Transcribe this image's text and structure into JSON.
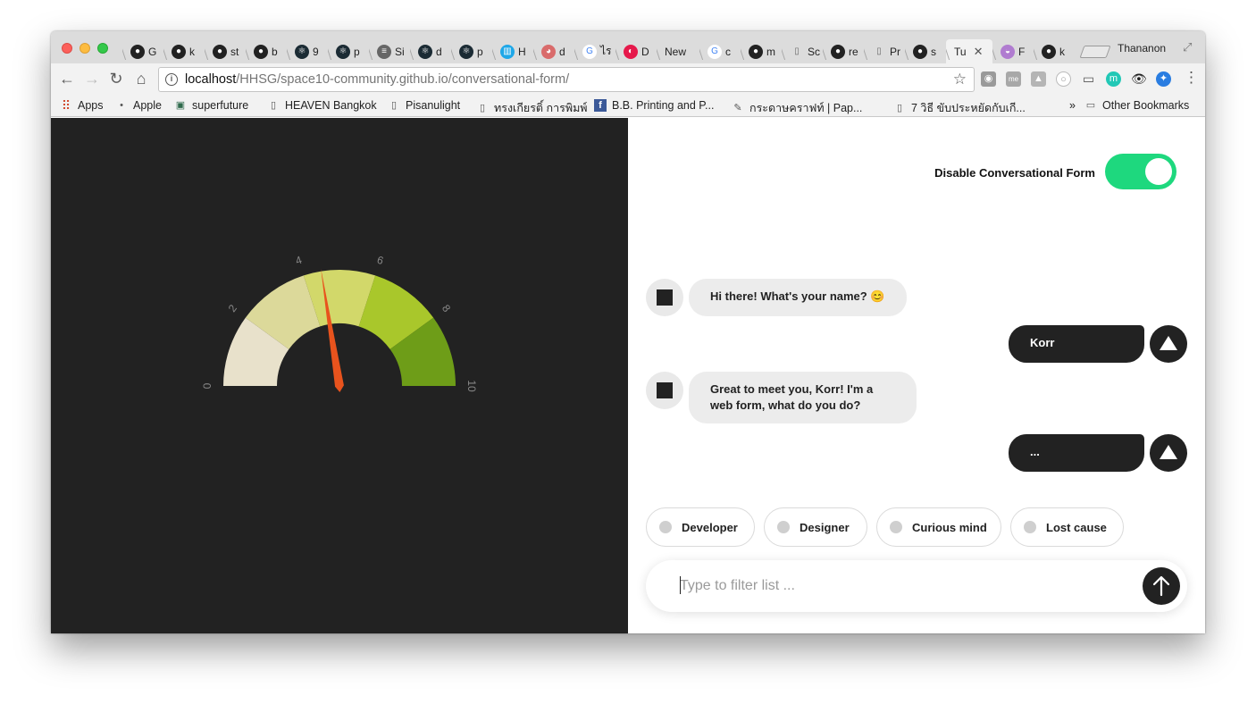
{
  "browser": {
    "tabs": [
      {
        "icon": "github-icon",
        "label": "G"
      },
      {
        "icon": "github-icon",
        "label": "k"
      },
      {
        "icon": "github-icon",
        "label": "st"
      },
      {
        "icon": "github-icon",
        "label": "b"
      },
      {
        "icon": "react-icon",
        "label": "9"
      },
      {
        "icon": "react-icon",
        "label": "p"
      },
      {
        "icon": "stack-icon",
        "label": "Si"
      },
      {
        "icon": "react-icon",
        "label": "d"
      },
      {
        "icon": "react-icon",
        "label": "p"
      },
      {
        "icon": "trello-icon",
        "label": "H"
      },
      {
        "icon": "colorful-icon",
        "label": "d"
      },
      {
        "icon": "google-icon",
        "label": "ไร"
      },
      {
        "icon": "red-circle-icon",
        "label": "D"
      },
      {
        "icon": "",
        "label": "New"
      },
      {
        "icon": "google-icon",
        "label": "c"
      },
      {
        "icon": "github-icon",
        "label": "m"
      },
      {
        "icon": "page-icon",
        "label": "Sc"
      },
      {
        "icon": "github-icon",
        "label": "re"
      },
      {
        "icon": "page-icon",
        "label": "Pr"
      },
      {
        "icon": "github-icon",
        "label": "s"
      },
      {
        "icon": "",
        "label": "Tu",
        "active": true,
        "close": "✕"
      },
      {
        "icon": "cake-icon",
        "label": "F"
      },
      {
        "icon": "github-icon",
        "label": "k"
      }
    ],
    "profile_name": "Thananon",
    "url_host": "localhost",
    "url_path": "/HHSG/space10-community.github.io/conversational-form/",
    "bookmarks": [
      {
        "icon": "apps-grid-icon",
        "label": "Apps"
      },
      {
        "icon": "apple-icon",
        "label": "Apple"
      },
      {
        "icon": "square-icon",
        "label": "superfuture"
      },
      {
        "icon": "page-icon",
        "label": "HEAVEN Bangkok"
      },
      {
        "icon": "page-icon",
        "label": "Pisanulight"
      },
      {
        "icon": "page-icon",
        "label": "ทรงเกียรติ์ การพิมพ์"
      },
      {
        "icon": "facebook-icon",
        "label": "B.B. Printing and P..."
      },
      {
        "icon": "paper-icon",
        "label": "กระดาษคราฟท์ | Pap..."
      },
      {
        "icon": "page-icon",
        "label": "7 วิธี ขับประหยัดกับเกี..."
      }
    ],
    "bookmarks_overflow": "»",
    "other_bookmarks": "Other Bookmarks"
  },
  "gauge": {
    "ticks": [
      "0",
      "2",
      "4",
      "6",
      "8",
      "10"
    ],
    "min": 0,
    "max": 10,
    "needle_value": 4.5,
    "segment_colors": [
      "#e8e1cb",
      "#dcd99a",
      "#d2d86a",
      "#a9c72b",
      "#6e9d18"
    ],
    "needle_color": "#e8531d",
    "label_color": "#888888"
  },
  "form": {
    "toggle_label": "Disable Conversational Form",
    "toggle_on": true,
    "toggle_color": "#1ed87e",
    "messages": [
      {
        "from": "robot",
        "text": "Hi there! What's your name? 😊"
      },
      {
        "from": "user",
        "text": "Korr"
      },
      {
        "from": "robot",
        "text": "Great to meet you, Korr! I'm a web form, what do you do?"
      },
      {
        "from": "user",
        "text": "..."
      }
    ],
    "options": [
      "Developer",
      "Designer",
      "Curious mind",
      "Lost cause"
    ],
    "input_placeholder": "Type to filter list ..."
  }
}
